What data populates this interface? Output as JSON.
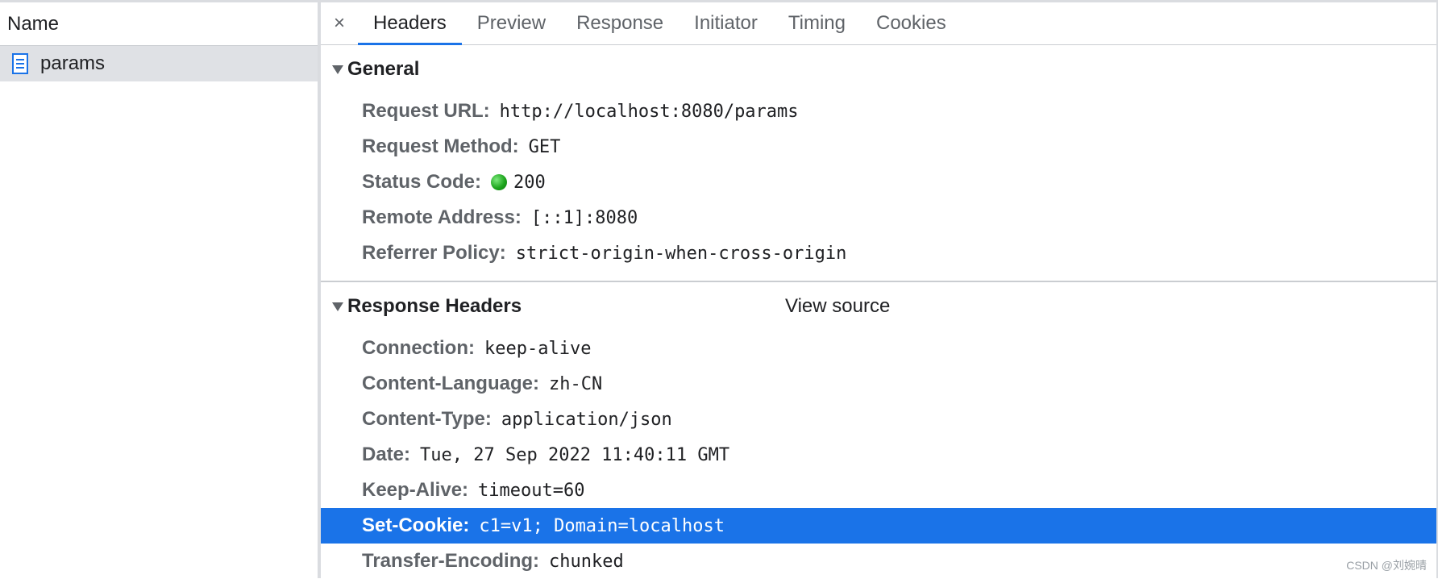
{
  "left": {
    "column_header": "Name",
    "requests": [
      {
        "name": "params",
        "icon": "document-icon"
      }
    ]
  },
  "tabs": {
    "close_label": "×",
    "items": [
      "Headers",
      "Preview",
      "Response",
      "Initiator",
      "Timing",
      "Cookies"
    ],
    "active": "Headers"
  },
  "general": {
    "title": "General",
    "rows": [
      {
        "key": "Request URL:",
        "value": "http://localhost:8080/params"
      },
      {
        "key": "Request Method:",
        "value": "GET"
      },
      {
        "key": "Status Code:",
        "value": "200"
      },
      {
        "key": "Remote Address:",
        "value": "[::1]:8080"
      },
      {
        "key": "Referrer Policy:",
        "value": "strict-origin-when-cross-origin"
      }
    ]
  },
  "response_headers": {
    "title": "Response Headers",
    "view_source": "View source",
    "rows": [
      {
        "key": "Connection:",
        "value": "keep-alive"
      },
      {
        "key": "Content-Language:",
        "value": "zh-CN"
      },
      {
        "key": "Content-Type:",
        "value": "application/json"
      },
      {
        "key": "Date:",
        "value": "Tue, 27 Sep 2022 11:40:11 GMT"
      },
      {
        "key": "Keep-Alive:",
        "value": "timeout=60"
      },
      {
        "key": "Set-Cookie:",
        "value": "c1=v1; Domain=localhost"
      },
      {
        "key": "Transfer-Encoding:",
        "value": "chunked"
      }
    ],
    "selected_row": "Set-Cookie:"
  },
  "colors": {
    "accent": "#1a73e8",
    "status_ok": "#1fa61f"
  },
  "watermark": "CSDN @刘婉晴"
}
